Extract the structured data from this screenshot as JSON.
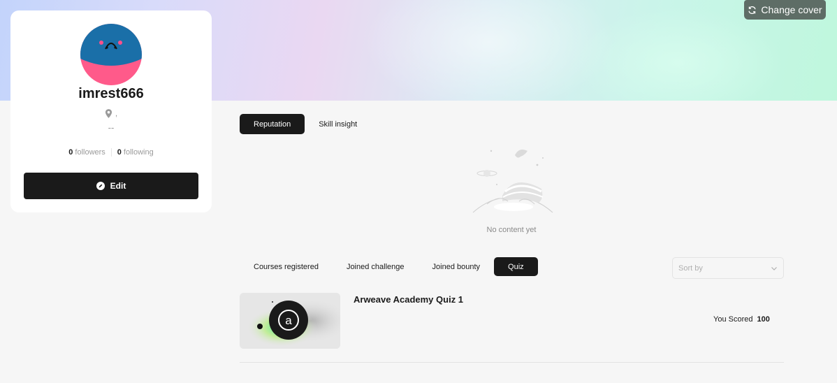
{
  "cover": {
    "change_cover_label": "Change cover",
    "colors": {
      "start": "#c3d4fb",
      "mid": "#ead8f2",
      "end": "#bff7dd"
    }
  },
  "profile": {
    "username": "imrest666",
    "location": ",",
    "bio": "--",
    "followers_count": "0",
    "followers_label": "followers",
    "following_count": "0",
    "following_label": "following",
    "edit_label": "Edit",
    "avatar_colors": {
      "top": "#1a6fa8",
      "bottom": "#ff5a8a"
    }
  },
  "top_tabs": [
    {
      "label": "Reputation",
      "active": true
    },
    {
      "label": "Skill insight",
      "active": false
    }
  ],
  "empty_state": {
    "text": "No content yet",
    "icon": "empty-planet-illustration"
  },
  "bottom_tabs": [
    {
      "label": "Courses registered",
      "active": false
    },
    {
      "label": "Joined challenge",
      "active": false
    },
    {
      "label": "Joined bounty",
      "active": false
    },
    {
      "label": "Quiz",
      "active": true
    }
  ],
  "sort": {
    "placeholder": "Sort by",
    "icon": "chevron-down-icon"
  },
  "quizzes": [
    {
      "title": "Arweave Academy Quiz 1",
      "score_label": "You Scored",
      "score": "100",
      "thumb_icon": "arweave-logo-icon"
    }
  ],
  "accent": "#1a1a1a"
}
